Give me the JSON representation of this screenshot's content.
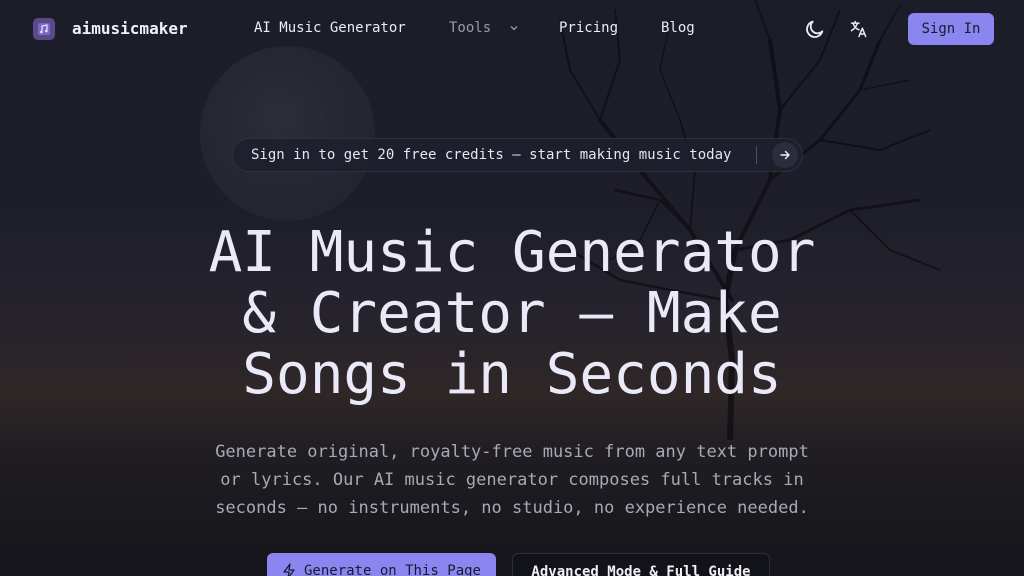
{
  "nav": {
    "brand": "aimusicmaker",
    "links": [
      {
        "label": "AI Music Generator"
      },
      {
        "label": "Tools"
      },
      {
        "label": "Pricing"
      },
      {
        "label": "Blog"
      }
    ],
    "sign_in": "Sign In"
  },
  "announcement": {
    "text": "Sign in to get 20 free credits — start making music today"
  },
  "hero": {
    "title_line1": "AI Music Generator",
    "title_line2": "& Creator — Make",
    "title_line3": "Songs in Seconds",
    "subtitle_line1": "Generate original, royalty-free music from any text prompt",
    "subtitle_line2": "or lyrics. Our AI music generator composes full tracks in",
    "subtitle_line3": "seconds — no instruments, no studio, no experience needed."
  },
  "cta": {
    "primary": "Generate on This Page",
    "secondary": "Advanced Mode & Full Guide"
  },
  "icons": {
    "logo": "music-note-icon",
    "theme": "moon-icon",
    "language": "translate-icon",
    "arrow": "arrow-right-icon",
    "lightning": "lightning-icon"
  },
  "colors": {
    "accent": "#8b85f0",
    "background": "#1b1d29",
    "text": "#e9e9f7",
    "muted": "#a9a9b6"
  }
}
